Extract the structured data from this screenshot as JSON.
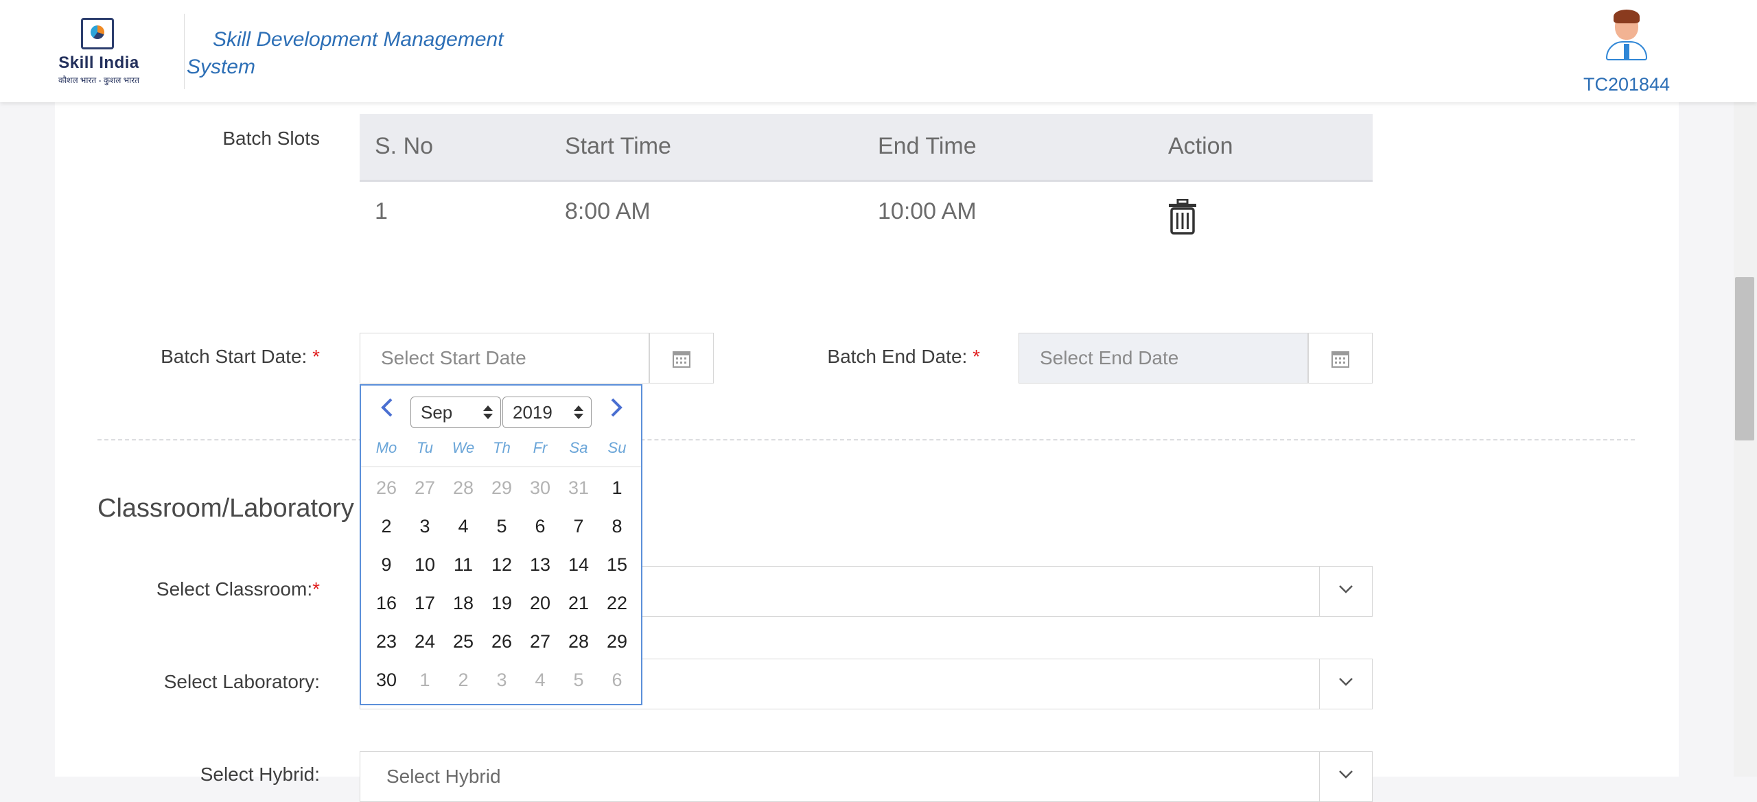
{
  "header": {
    "logo_text": "Skill India",
    "logo_sub": "कौशल भारत - कुशल भारत",
    "app_title": "Skill Development Management System",
    "user_id": "TC201844"
  },
  "batch_slots": {
    "label": "Batch Slots",
    "columns": [
      "S. No",
      "Start Time",
      "End Time",
      "Action"
    ],
    "rows": [
      {
        "sno": "1",
        "start": "8:00 AM",
        "end": "10:00 AM",
        "action_icon": "trash-icon"
      }
    ]
  },
  "batch_start": {
    "label": "Batch Start Date:",
    "required_mark": "*",
    "placeholder": "Select Start Date",
    "icon": "calendar-icon"
  },
  "batch_end": {
    "label": "Batch End Date:",
    "required_mark": "*",
    "placeholder": "Select End Date",
    "icon": "calendar-icon"
  },
  "section": {
    "title": "Classroom/Laboratory"
  },
  "classroom": {
    "label": "Select Classroom:",
    "required_mark": "*",
    "value": ""
  },
  "laboratory": {
    "label": "Select Laboratory:",
    "value": ""
  },
  "hybrid": {
    "label": "Select Hybrid:",
    "value": "Select Hybrid"
  },
  "datepicker": {
    "month": "Sep",
    "year": "2019",
    "weekdays": [
      "Mo",
      "Tu",
      "We",
      "Th",
      "Fr",
      "Sa",
      "Su"
    ],
    "weeks": [
      [
        {
          "d": "26",
          "m": true
        },
        {
          "d": "27",
          "m": true
        },
        {
          "d": "28",
          "m": true
        },
        {
          "d": "29",
          "m": true
        },
        {
          "d": "30",
          "m": true
        },
        {
          "d": "31",
          "m": true
        },
        {
          "d": "1",
          "m": false
        }
      ],
      [
        {
          "d": "2",
          "m": false
        },
        {
          "d": "3",
          "m": false
        },
        {
          "d": "4",
          "m": false
        },
        {
          "d": "5",
          "m": false
        },
        {
          "d": "6",
          "m": false
        },
        {
          "d": "7",
          "m": false
        },
        {
          "d": "8",
          "m": false
        }
      ],
      [
        {
          "d": "9",
          "m": false
        },
        {
          "d": "10",
          "m": false
        },
        {
          "d": "11",
          "m": false
        },
        {
          "d": "12",
          "m": false
        },
        {
          "d": "13",
          "m": false
        },
        {
          "d": "14",
          "m": false
        },
        {
          "d": "15",
          "m": false
        }
      ],
      [
        {
          "d": "16",
          "m": false
        },
        {
          "d": "17",
          "m": false
        },
        {
          "d": "18",
          "m": false
        },
        {
          "d": "19",
          "m": false
        },
        {
          "d": "20",
          "m": false
        },
        {
          "d": "21",
          "m": false
        },
        {
          "d": "22",
          "m": false
        }
      ],
      [
        {
          "d": "23",
          "m": false
        },
        {
          "d": "24",
          "m": false
        },
        {
          "d": "25",
          "m": false
        },
        {
          "d": "26",
          "m": false
        },
        {
          "d": "27",
          "m": false
        },
        {
          "d": "28",
          "m": false
        },
        {
          "d": "29",
          "m": false
        }
      ],
      [
        {
          "d": "30",
          "m": false
        },
        {
          "d": "1",
          "m": true
        },
        {
          "d": "2",
          "m": true
        },
        {
          "d": "3",
          "m": true
        },
        {
          "d": "4",
          "m": true
        },
        {
          "d": "5",
          "m": true
        },
        {
          "d": "6",
          "m": true
        }
      ]
    ]
  },
  "colors": {
    "brand_blue": "#2d6fb6",
    "required_red": "#e02020",
    "datepicker_border": "#5b8fd9",
    "weekday_blue": "#6aa5d8",
    "nav_arrow": "#4a6fd1"
  }
}
